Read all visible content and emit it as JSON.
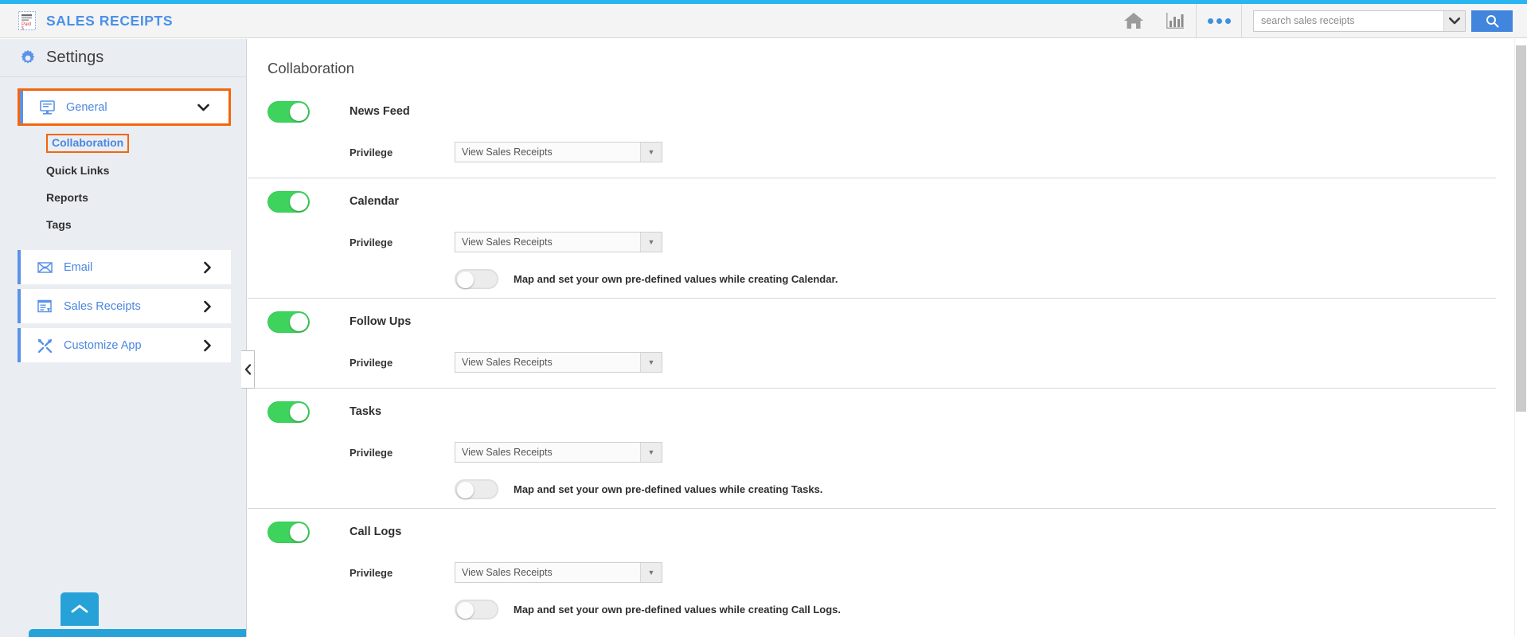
{
  "theme": {
    "accent_blue": "#29b6f0",
    "brand_blue": "#4a90e8",
    "link_blue": "#4a86e0",
    "highlight_orange": "#f4650d",
    "toggle_on_green": "#3dd35c",
    "search_button_blue": "#4285dd",
    "sidebar_bg": "#eaeef3"
  },
  "header": {
    "app_icon": "receipt-icon",
    "app_title": "SALES RECEIPTS",
    "icons": [
      {
        "name": "home-icon",
        "label": "Home"
      },
      {
        "name": "analytics-icon",
        "label": "Analytics"
      },
      {
        "name": "more-options-icon",
        "label": "More"
      }
    ],
    "search": {
      "placeholder": "search sales receipts",
      "value": "",
      "dropdown_icon": "chevron-down-icon",
      "submit_icon": "search-icon"
    }
  },
  "sidebar": {
    "title": "Settings",
    "title_icon": "gear-icon",
    "general": {
      "label": "General",
      "icon": "monitor-icon",
      "expanded": true,
      "chevron": "chevron-down-icon",
      "highlighted": true
    },
    "sub_items": [
      {
        "label": "Collaboration",
        "active": true,
        "highlighted": true
      },
      {
        "label": "Quick Links",
        "active": false,
        "highlighted": false
      },
      {
        "label": "Reports",
        "active": false,
        "highlighted": false
      },
      {
        "label": "Tags",
        "active": false,
        "highlighted": false
      }
    ],
    "groups": [
      {
        "label": "Email",
        "icon": "envelope-icon",
        "chevron": "chevron-right-icon"
      },
      {
        "label": "Sales Receipts",
        "icon": "document-icon",
        "chevron": "chevron-right-icon"
      },
      {
        "label": "Customize App",
        "icon": "tools-icon",
        "chevron": "chevron-right-icon"
      }
    ],
    "collapse_handle_icon": "chevron-left-icon",
    "scroll_top_icon": "chevron-up-icon"
  },
  "main": {
    "page_title": "Collaboration",
    "privilege_label": "Privilege",
    "select_arrow_icon": "caret-down-icon",
    "features": [
      {
        "name": "News Feed",
        "enabled": true,
        "privilege": "View Sales Receipts",
        "has_map_toggle": false,
        "map_enabled": false,
        "map_text": ""
      },
      {
        "name": "Calendar",
        "enabled": true,
        "privilege": "View Sales Receipts",
        "has_map_toggle": true,
        "map_enabled": false,
        "map_text": "Map and set your own pre-defined values while creating Calendar."
      },
      {
        "name": "Follow Ups",
        "enabled": true,
        "privilege": "View Sales Receipts",
        "has_map_toggle": false,
        "map_enabled": false,
        "map_text": ""
      },
      {
        "name": "Tasks",
        "enabled": true,
        "privilege": "View Sales Receipts",
        "has_map_toggle": true,
        "map_enabled": false,
        "map_text": "Map and set your own pre-defined values while creating Tasks."
      },
      {
        "name": "Call Logs",
        "enabled": true,
        "privilege": "View Sales Receipts",
        "has_map_toggle": true,
        "map_enabled": false,
        "map_text": "Map and set your own pre-defined values while creating Call Logs."
      }
    ]
  }
}
